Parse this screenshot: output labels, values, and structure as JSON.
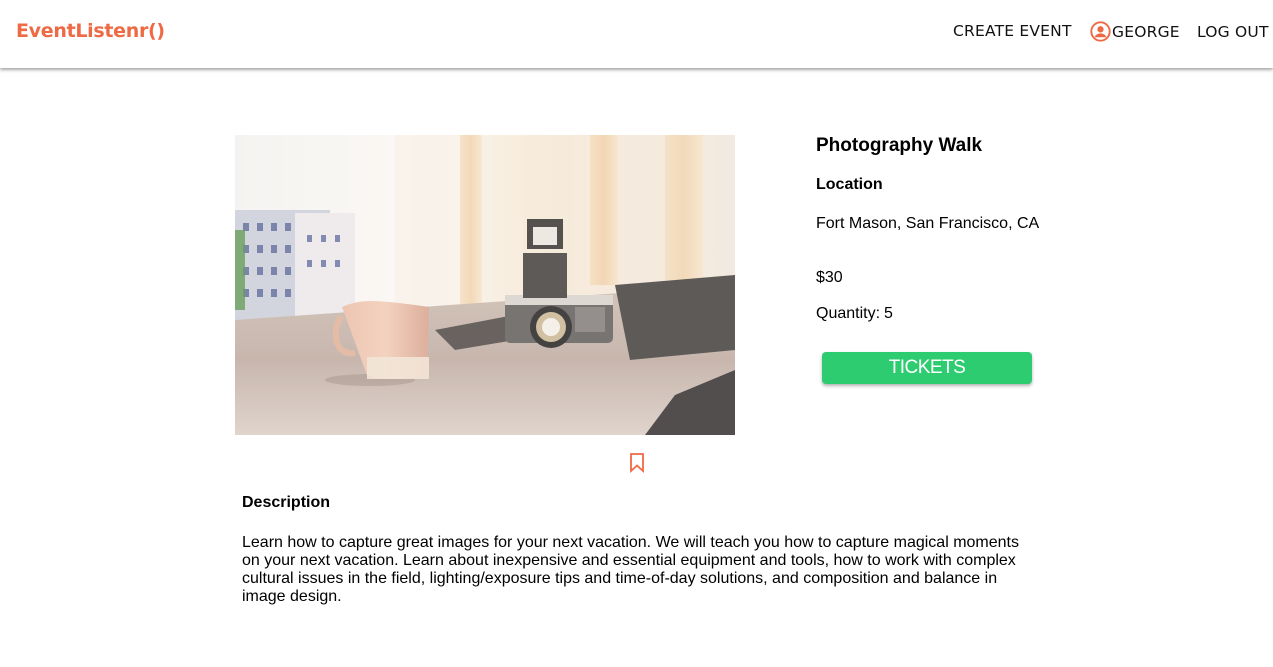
{
  "theme": {
    "brand_color": "#ee6a44",
    "accent_green": "#2ecc71",
    "text_color": "#000000"
  },
  "navbar": {
    "brand": "EventListenr()",
    "create_event": "CREATE EVENT",
    "user_name": "GEORGE",
    "user_icon": "user-circle-icon",
    "logout": "LOG OUT"
  },
  "event": {
    "title": "Photography Walk",
    "location_label": "Location",
    "location": "Fort Mason, San Francisco, CA",
    "price": "$30",
    "quantity_label": "Quantity:",
    "quantity_value": "5",
    "tickets_button": "TICKETS",
    "bookmark_icon": "bookmark-icon",
    "description_label": "Description",
    "description": "Learn how to capture great images for your next vacation. We will teach you how to capture magical moments on your next vacation. Learn about inexpensive and essential equipment and tools, how to work with complex cultural issues in the field, lighting/exposure tips and time-of-day solutions, and composition and balance in image design."
  }
}
